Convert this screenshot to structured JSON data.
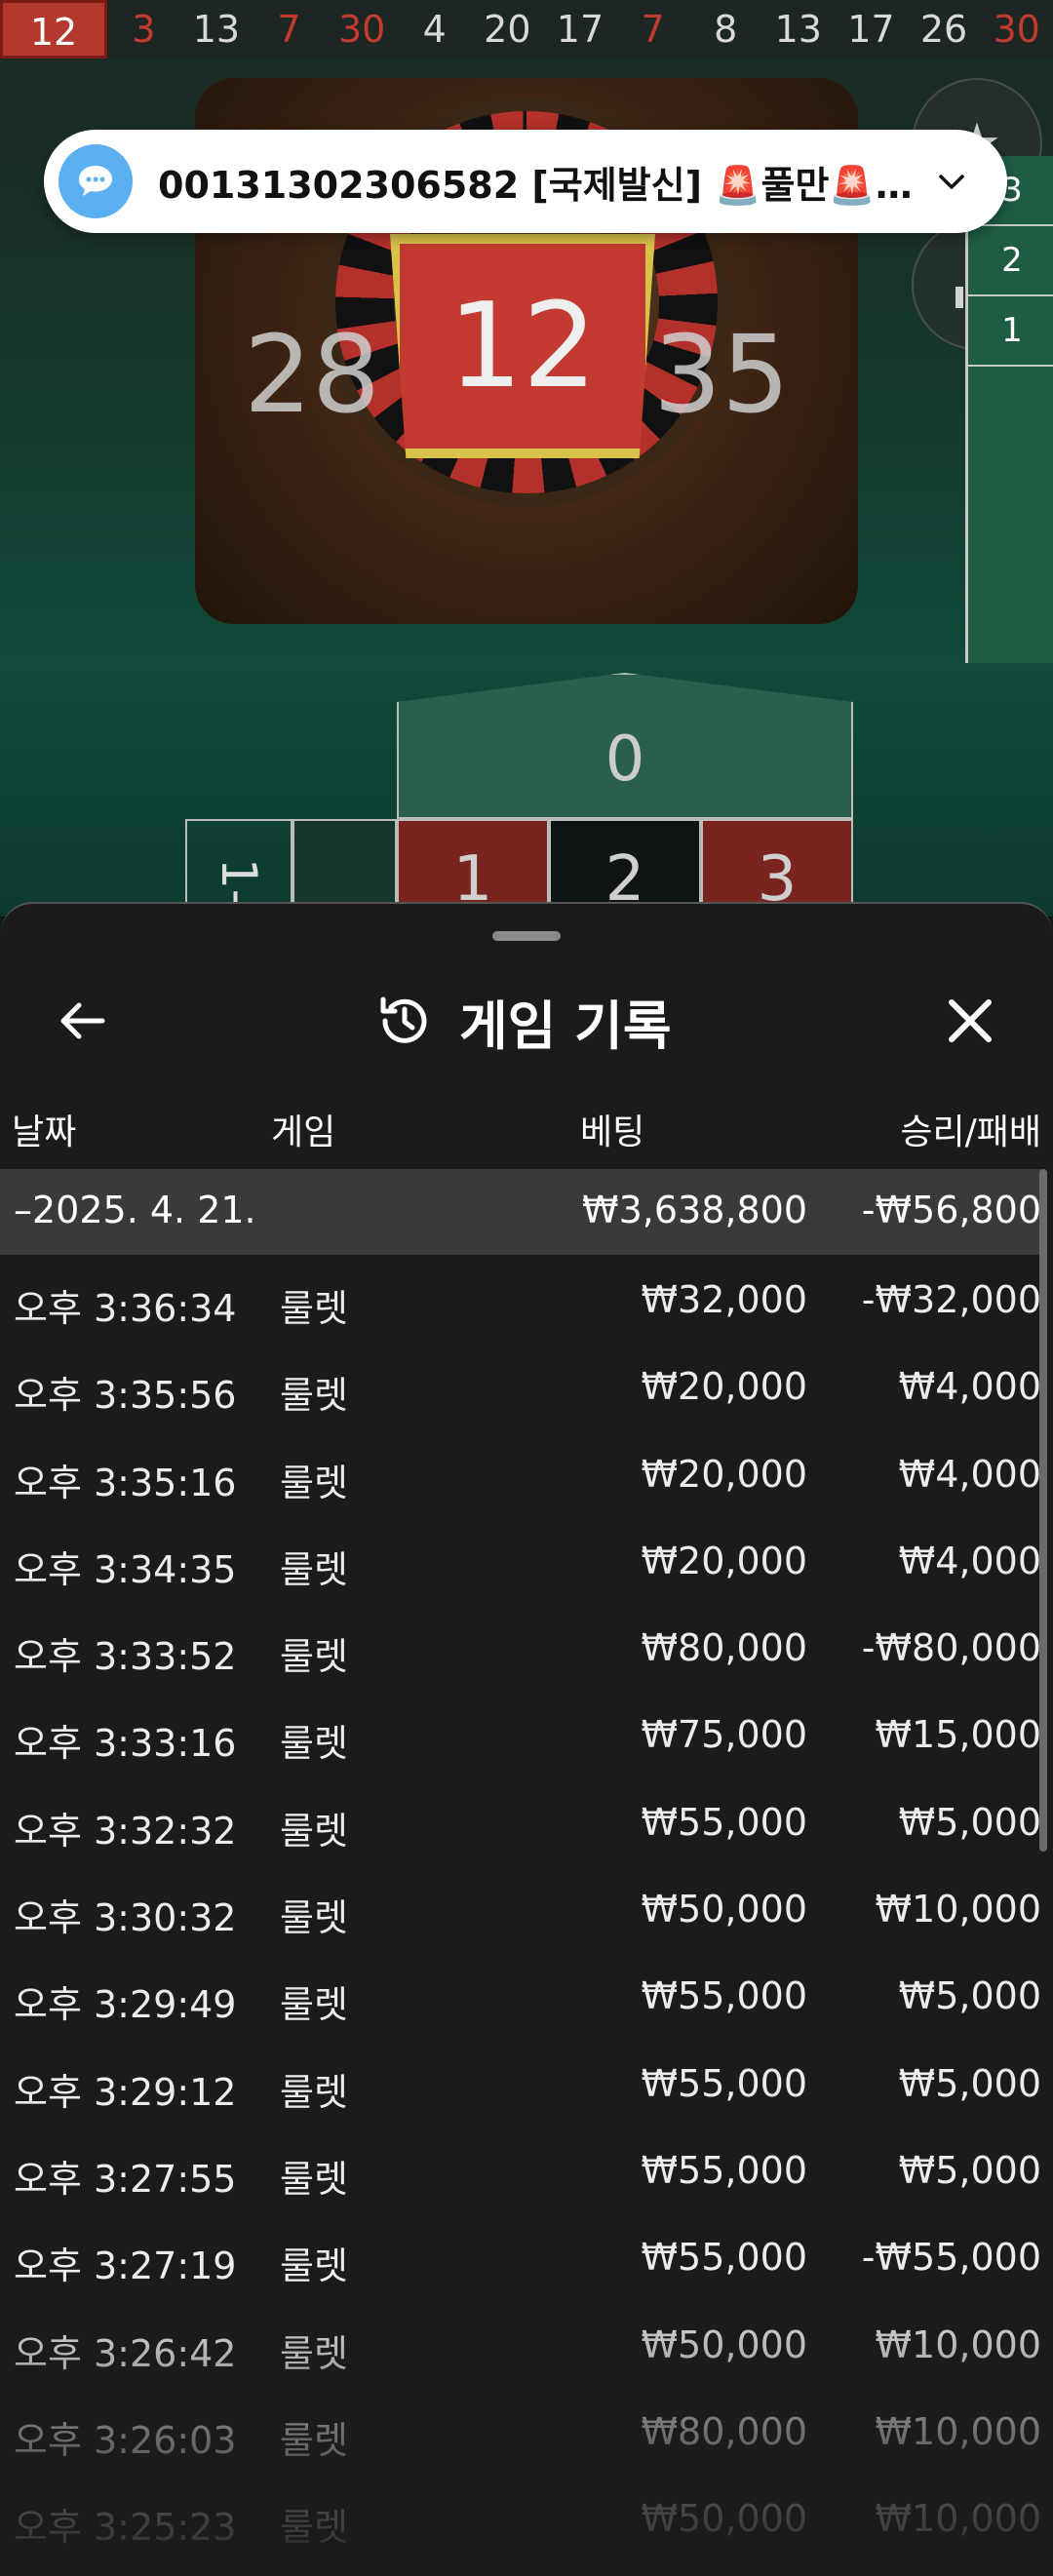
{
  "history_strip": [
    {
      "value": "12",
      "color": "red"
    },
    {
      "value": "3",
      "color": "red"
    },
    {
      "value": "13",
      "color": "black"
    },
    {
      "value": "7",
      "color": "red"
    },
    {
      "value": "30",
      "color": "red"
    },
    {
      "value": "4",
      "color": "black"
    },
    {
      "value": "20",
      "color": "black"
    },
    {
      "value": "17",
      "color": "black"
    },
    {
      "value": "7",
      "color": "red"
    },
    {
      "value": "8",
      "color": "black"
    },
    {
      "value": "13",
      "color": "black"
    },
    {
      "value": "17",
      "color": "black"
    },
    {
      "value": "26",
      "color": "black"
    },
    {
      "value": "30",
      "color": "red"
    }
  ],
  "game": {
    "result": "12",
    "neighbor_left": "28",
    "neighbor_right": "35",
    "zero": "0",
    "row_numbers": [
      "1",
      "2",
      "3"
    ],
    "left_label": "1-1",
    "board_right_cells": [
      "3",
      "2",
      "1"
    ]
  },
  "notification": {
    "text": "00131302306582 [국제발신] 🚨풀만🚨...",
    "icon": "chat-bubble-icon"
  },
  "sheet": {
    "title": "게임 기록",
    "columns": {
      "date": "날짜",
      "game": "게임",
      "bet": "베팅",
      "result": "승리/패배"
    },
    "day": {
      "date": "–2025. 4. 21.",
      "bet": "₩3,638,800",
      "result": "-₩56,800"
    },
    "rows": [
      {
        "time": "오후 3:36:34",
        "game": "룰렛",
        "bet": "₩32,000",
        "result": "-₩32,000"
      },
      {
        "time": "오후 3:35:56",
        "game": "룰렛",
        "bet": "₩20,000",
        "result": "₩4,000"
      },
      {
        "time": "오후 3:35:16",
        "game": "룰렛",
        "bet": "₩20,000",
        "result": "₩4,000"
      },
      {
        "time": "오후 3:34:35",
        "game": "룰렛",
        "bet": "₩20,000",
        "result": "₩4,000"
      },
      {
        "time": "오후 3:33:52",
        "game": "룰렛",
        "bet": "₩80,000",
        "result": "-₩80,000"
      },
      {
        "time": "오후 3:33:16",
        "game": "룰렛",
        "bet": "₩75,000",
        "result": "₩15,000"
      },
      {
        "time": "오후 3:32:32",
        "game": "룰렛",
        "bet": "₩55,000",
        "result": "₩5,000"
      },
      {
        "time": "오후 3:30:32",
        "game": "룰렛",
        "bet": "₩50,000",
        "result": "₩10,000"
      },
      {
        "time": "오후 3:29:49",
        "game": "룰렛",
        "bet": "₩55,000",
        "result": "₩5,000"
      },
      {
        "time": "오후 3:29:12",
        "game": "룰렛",
        "bet": "₩55,000",
        "result": "₩5,000"
      },
      {
        "time": "오후 3:27:55",
        "game": "룰렛",
        "bet": "₩55,000",
        "result": "₩5,000"
      },
      {
        "time": "오후 3:27:19",
        "game": "룰렛",
        "bet": "₩55,000",
        "result": "-₩55,000"
      },
      {
        "time": "오후 3:26:42",
        "game": "룰렛",
        "bet": "₩50,000",
        "result": "₩10,000"
      },
      {
        "time": "오후 3:26:03",
        "game": "룰렛",
        "bet": "₩80,000",
        "result": "₩10,000"
      },
      {
        "time": "오후 3:25:23",
        "game": "룰렛",
        "bet": "₩50,000",
        "result": "₩10,000"
      }
    ]
  },
  "colors": {
    "red": "#c23a30",
    "sheet_bg": "#1b1b1b",
    "day_row_bg": "#3a3a3a",
    "notif_icon_bg": "#5ab0f0"
  }
}
